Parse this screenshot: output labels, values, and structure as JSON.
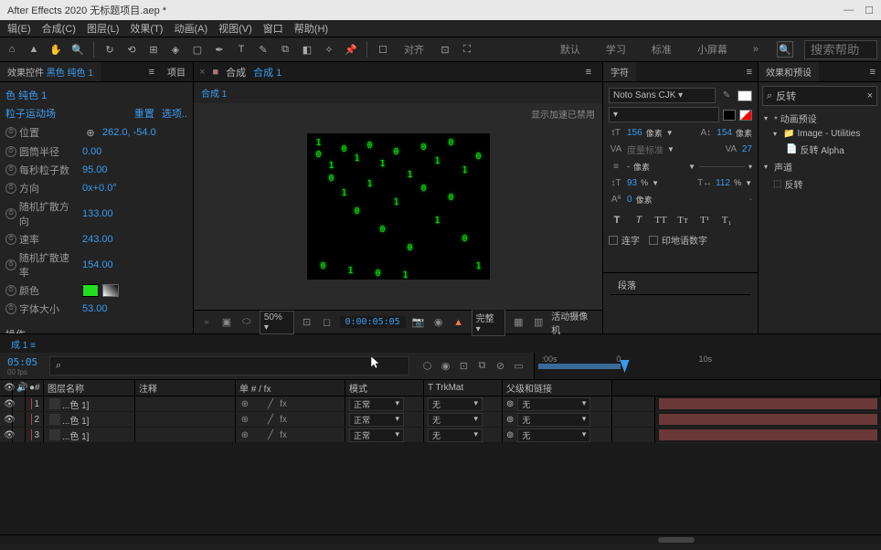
{
  "titlebar": {
    "text": "After Effects 2020  无标题项目.aep *"
  },
  "menu": [
    "辑(E)",
    "合成(C)",
    "图层(L)",
    "效果(T)",
    "动画(A)",
    "视图(V)",
    "窗口",
    "帮助(H)"
  ],
  "toolbar_right": {
    "align": "对齐",
    "default": "默认",
    "learn": "学习",
    "standard": "标准",
    "small": "小屏幕",
    "search_ph": "搜索帮助"
  },
  "effect_panel": {
    "tab_prefix": "效果控件",
    "tab_target": "黑色 纯色 1",
    "project_tab": "项目",
    "layer": "色 纯色 1",
    "effect_name": "粒子运动场",
    "reset": "重置",
    "options": "选项..",
    "props": {
      "position": {
        "label": "位置",
        "value": "262.0, -54.0"
      },
      "radius": {
        "label": "圆筒半径",
        "value": "0.00"
      },
      "rate": {
        "label": "每秒粒子数",
        "value": "95.00"
      },
      "direction": {
        "label": "方向",
        "value": "0x+0.0°"
      },
      "spread": {
        "label": "随机扩散方向",
        "value": "133.00"
      },
      "velocity": {
        "label": "速率",
        "value": "243.00"
      },
      "vel_spread": {
        "label": "随机扩散速率",
        "value": "154.00"
      },
      "color": {
        "label": "颜色"
      },
      "size": {
        "label": "字体大小",
        "value": "53.00"
      }
    },
    "op1": "操作",
    "op2": "操作"
  },
  "viewer": {
    "tab": "合成",
    "comp": "合成 1",
    "crumb": "合成 1",
    "accel": "显示加速已禁用",
    "zoom": "50%",
    "timecode": "0:00:05:05",
    "quality": "完整",
    "camera": "活动摄像机"
  },
  "char": {
    "title": "字符",
    "font": "Noto Sans CJK",
    "size": "156",
    "size_unit": "像素",
    "leading": "154",
    "leading_unit": "像素",
    "kern": "27",
    "tracking_unit": "像素",
    "vscale": "93",
    "hscale": "112",
    "pct": "%",
    "baseline": "0",
    "baseline_unit": "像素",
    "ligature": "连字",
    "hindi": "印地语数字"
  },
  "effects_browser": {
    "title": "效果和预设",
    "search": "反转",
    "cat1": "* 动画预设",
    "sub1": "Image - Utilities",
    "item1": "反转 Alpha",
    "cat2": "声道",
    "item2": "反转"
  },
  "para": {
    "title": "段落"
  },
  "timeline": {
    "tab": "成 1",
    "tc": "05:05",
    "fps": "00 fps",
    "cols": {
      "name": "图层名称",
      "comment": "注释",
      "switches": "单 # / fx",
      "mode": "模式",
      "trkmat": "T   TrkMat",
      "parent": "父级和链接"
    },
    "mode_normal": "正常",
    "none": "无",
    "ruler": {
      "t0": ":00s",
      "t1": "0",
      "t2": "10s"
    },
    "layers": [
      {
        "num": "1",
        "name": "...色 1]"
      },
      {
        "num": "2",
        "name": "...色 1]"
      },
      {
        "num": "3",
        "name": "...色 1]"
      }
    ]
  }
}
